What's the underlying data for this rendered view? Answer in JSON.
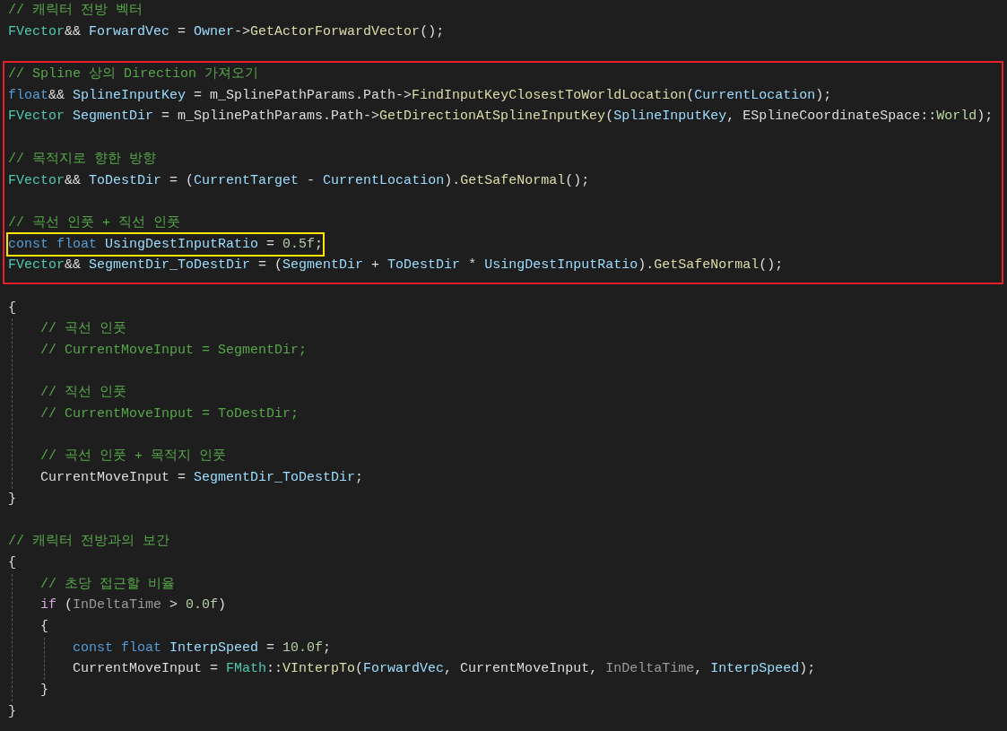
{
  "code": [
    {
      "kind": "line",
      "tokens": [
        {
          "text": "// 캐릭터 전방 벡터",
          "kind": "comment"
        }
      ]
    },
    {
      "kind": "line",
      "tokens": [
        {
          "text": "FVector",
          "kind": "type"
        },
        {
          "text": "&& ",
          "kind": "plain"
        },
        {
          "text": "ForwardVec",
          "kind": "variable"
        },
        {
          "text": " = ",
          "kind": "plain"
        },
        {
          "text": "Owner",
          "kind": "variable"
        },
        {
          "text": "->",
          "kind": "plain"
        },
        {
          "text": "GetActorForwardVector",
          "kind": "function"
        },
        {
          "text": "();",
          "kind": "plain"
        }
      ]
    },
    {
      "kind": "blank"
    },
    {
      "kind": "frame",
      "color": "#e8202a",
      "items": [
        {
          "kind": "line",
          "tokens": [
            {
              "text": "// Spline 상의 Direction 가져오기",
              "kind": "comment"
            }
          ]
        },
        {
          "kind": "line",
          "tokens": [
            {
              "text": "float",
              "kind": "keyword"
            },
            {
              "text": "&& ",
              "kind": "plain"
            },
            {
              "text": "SplineInputKey",
              "kind": "variable"
            },
            {
              "text": " = m_SplinePathParams.Path->",
              "kind": "plain"
            },
            {
              "text": "FindInputKeyClosestToWorldLocation",
              "kind": "function"
            },
            {
              "text": "(",
              "kind": "plain"
            },
            {
              "text": "CurrentLocation",
              "kind": "variable"
            },
            {
              "text": ");",
              "kind": "plain"
            }
          ]
        },
        {
          "kind": "line",
          "tokens": [
            {
              "text": "FVector ",
              "kind": "type"
            },
            {
              "text": "SegmentDir",
              "kind": "variable"
            },
            {
              "text": " = m_SplinePathParams.Path->",
              "kind": "plain"
            },
            {
              "text": "GetDirectionAtSplineInputKey",
              "kind": "function"
            },
            {
              "text": "(",
              "kind": "plain"
            },
            {
              "text": "SplineInputKey",
              "kind": "variable"
            },
            {
              "text": ", ESplineCoordinateSpace::",
              "kind": "plain"
            },
            {
              "text": "World",
              "kind": "enum"
            },
            {
              "text": ");",
              "kind": "plain"
            }
          ]
        },
        {
          "kind": "blank"
        },
        {
          "kind": "line",
          "tokens": [
            {
              "text": "// 목적지로 향한 방향",
              "kind": "comment"
            }
          ]
        },
        {
          "kind": "line",
          "tokens": [
            {
              "text": "FVector",
              "kind": "type"
            },
            {
              "text": "&& ",
              "kind": "plain"
            },
            {
              "text": "ToDestDir",
              "kind": "variable"
            },
            {
              "text": " = (",
              "kind": "plain"
            },
            {
              "text": "CurrentTarget",
              "kind": "variable"
            },
            {
              "text": " - ",
              "kind": "plain"
            },
            {
              "text": "CurrentLocation",
              "kind": "variable"
            },
            {
              "text": ").",
              "kind": "plain"
            },
            {
              "text": "GetSafeNormal",
              "kind": "function"
            },
            {
              "text": "();",
              "kind": "plain"
            }
          ]
        },
        {
          "kind": "blank"
        },
        {
          "kind": "line",
          "tokens": [
            {
              "text": "// 곡선 인풋 + 직선 인풋",
              "kind": "comment"
            }
          ]
        },
        {
          "kind": "frame",
          "color": "#ffe500",
          "items": [
            {
              "kind": "line",
              "tokens": [
                {
                  "text": "const float ",
                  "kind": "keyword"
                },
                {
                  "text": "UsingDestInputRatio",
                  "kind": "variable"
                },
                {
                  "text": " = ",
                  "kind": "plain"
                },
                {
                  "text": "0.5f",
                  "kind": "number"
                },
                {
                  "text": ";",
                  "kind": "plain"
                }
              ]
            }
          ]
        },
        {
          "kind": "line",
          "tokens": [
            {
              "text": "FVector",
              "kind": "type"
            },
            {
              "text": "&& ",
              "kind": "plain"
            },
            {
              "text": "SegmentDir_ToDestDir",
              "kind": "variable"
            },
            {
              "text": " = (",
              "kind": "plain"
            },
            {
              "text": "SegmentDir",
              "kind": "variable"
            },
            {
              "text": " + ",
              "kind": "plain"
            },
            {
              "text": "ToDestDir",
              "kind": "variable"
            },
            {
              "text": " * ",
              "kind": "plain"
            },
            {
              "text": "UsingDestInputRatio",
              "kind": "variable"
            },
            {
              "text": ").",
              "kind": "plain"
            },
            {
              "text": "GetSafeNormal",
              "kind": "function"
            },
            {
              "text": "();",
              "kind": "plain"
            }
          ]
        }
      ]
    },
    {
      "kind": "blank"
    },
    {
      "kind": "block",
      "open": [
        {
          "text": "{",
          "kind": "plain"
        }
      ],
      "close": [
        {
          "text": "}",
          "kind": "plain"
        }
      ],
      "children": [
        {
          "kind": "line",
          "tokens": [
            {
              "text": "// 곡선 인풋",
              "kind": "comment"
            }
          ]
        },
        {
          "kind": "line",
          "tokens": [
            {
              "text": "// CurrentMoveInput = SegmentDir;",
              "kind": "comment"
            }
          ]
        },
        {
          "kind": "blank"
        },
        {
          "kind": "line",
          "tokens": [
            {
              "text": "// 직선 인풋",
              "kind": "comment"
            }
          ]
        },
        {
          "kind": "line",
          "tokens": [
            {
              "text": "// CurrentMoveInput = ToDestDir;",
              "kind": "comment"
            }
          ]
        },
        {
          "kind": "blank"
        },
        {
          "kind": "line",
          "tokens": [
            {
              "text": "// 곡선 인풋 + 목적지 인풋",
              "kind": "comment"
            }
          ]
        },
        {
          "kind": "line",
          "tokens": [
            {
              "text": "CurrentMoveInput = ",
              "kind": "plain"
            },
            {
              "text": "SegmentDir_ToDestDir",
              "kind": "variable"
            },
            {
              "text": ";",
              "kind": "plain"
            }
          ]
        }
      ]
    },
    {
      "kind": "blank"
    },
    {
      "kind": "line",
      "tokens": [
        {
          "text": "// 캐릭터 전방과의 보간",
          "kind": "comment"
        }
      ]
    },
    {
      "kind": "block",
      "open": [
        {
          "text": "{",
          "kind": "plain"
        }
      ],
      "close": [
        {
          "text": "}",
          "kind": "plain"
        }
      ],
      "children": [
        {
          "kind": "line",
          "tokens": [
            {
              "text": "// 초당 접근할 비율",
              "kind": "comment"
            }
          ]
        },
        {
          "kind": "line",
          "tokens": [
            {
              "text": "if",
              "kind": "control"
            },
            {
              "text": " (",
              "kind": "plain"
            },
            {
              "text": "InDeltaTime",
              "kind": "parameter"
            },
            {
              "text": " > ",
              "kind": "plain"
            },
            {
              "text": "0.0f",
              "kind": "number"
            },
            {
              "text": ")",
              "kind": "plain"
            }
          ]
        },
        {
          "kind": "block",
          "open": [
            {
              "text": "{",
              "kind": "plain"
            }
          ],
          "close": [
            {
              "text": "}",
              "kind": "plain"
            }
          ],
          "children": [
            {
              "kind": "line",
              "tokens": [
                {
                  "text": "const float ",
                  "kind": "keyword"
                },
                {
                  "text": "InterpSpeed",
                  "kind": "variable"
                },
                {
                  "text": " = ",
                  "kind": "plain"
                },
                {
                  "text": "10.0f",
                  "kind": "number"
                },
                {
                  "text": ";",
                  "kind": "plain"
                }
              ]
            },
            {
              "kind": "line",
              "tokens": [
                {
                  "text": "CurrentMoveInput = ",
                  "kind": "plain"
                },
                {
                  "text": "FMath",
                  "kind": "type"
                },
                {
                  "text": "::",
                  "kind": "plain"
                },
                {
                  "text": "VInterpTo",
                  "kind": "function"
                },
                {
                  "text": "(",
                  "kind": "plain"
                },
                {
                  "text": "ForwardVec",
                  "kind": "variable"
                },
                {
                  "text": ", CurrentMoveInput, ",
                  "kind": "plain"
                },
                {
                  "text": "InDeltaTime",
                  "kind": "parameter"
                },
                {
                  "text": ", ",
                  "kind": "plain"
                },
                {
                  "text": "InterpSpeed",
                  "kind": "variable"
                },
                {
                  "text": ");",
                  "kind": "plain"
                }
              ]
            }
          ]
        }
      ]
    }
  ]
}
